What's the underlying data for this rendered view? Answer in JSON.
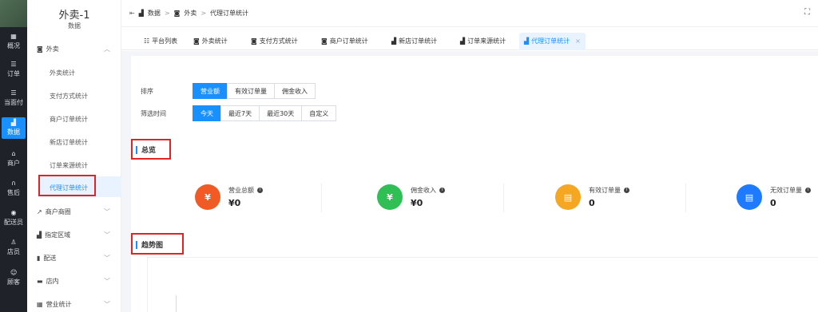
{
  "rail": {
    "items": [
      {
        "label": "概况",
        "icon": "grid-icon"
      },
      {
        "label": "订单",
        "icon": "list-icon"
      },
      {
        "label": "当面付",
        "icon": "list-icon"
      },
      {
        "label": "数据",
        "icon": "bar-chart-icon",
        "active": true
      },
      {
        "label": "商户",
        "icon": "store-icon"
      },
      {
        "label": "售后",
        "icon": "headset-icon"
      },
      {
        "label": "配送员",
        "icon": "bike-icon"
      },
      {
        "label": "店员",
        "icon": "user-icon"
      },
      {
        "label": "顾客",
        "icon": "smile-icon"
      }
    ]
  },
  "sidebar": {
    "title": "外卖-1",
    "subtitle": "数据",
    "group_waimai": "外卖",
    "items": [
      "外卖统计",
      "支付方式统计",
      "商户订单统计",
      "新店订单统计",
      "订单来源统计",
      "代理订单统计"
    ],
    "groups": [
      "商户商圈",
      "指定区域",
      "配送",
      "店内",
      "营业统计"
    ]
  },
  "header": {
    "breadcrumb": [
      "数据",
      "外卖",
      "代理订单统计"
    ],
    "sep": ">"
  },
  "tabs": [
    "平台列表",
    "外卖统计",
    "支付方式统计",
    "商户订单统计",
    "新店订单统计",
    "订单来源统计",
    "代理订单统计"
  ],
  "filters": {
    "sort_label": "排序",
    "sort_options": [
      "营业额",
      "有效订单量",
      "佣金收入"
    ],
    "time_label": "筛选时间",
    "time_options": [
      "今天",
      "最近7天",
      "最近30天",
      "自定义"
    ]
  },
  "overview": {
    "title": "总览",
    "stats": [
      {
        "label": "营业总额",
        "value": "¥0",
        "glyph": "¥",
        "color": "#f15a24"
      },
      {
        "label": "佣金收入",
        "value": "¥0",
        "glyph": "¥",
        "color": "#2fbf55"
      },
      {
        "label": "有效订单量",
        "value": "0",
        "glyph": "▤",
        "color": "#f5a623"
      },
      {
        "label": "无效订单量",
        "value": "0",
        "glyph": "▤",
        "color": "#1e7bff"
      }
    ]
  },
  "trend": {
    "title": "趋势图"
  },
  "colors": {
    "accent": "#1890ff",
    "highlight": "#e02424",
    "rail_bg": "#1f2329"
  }
}
